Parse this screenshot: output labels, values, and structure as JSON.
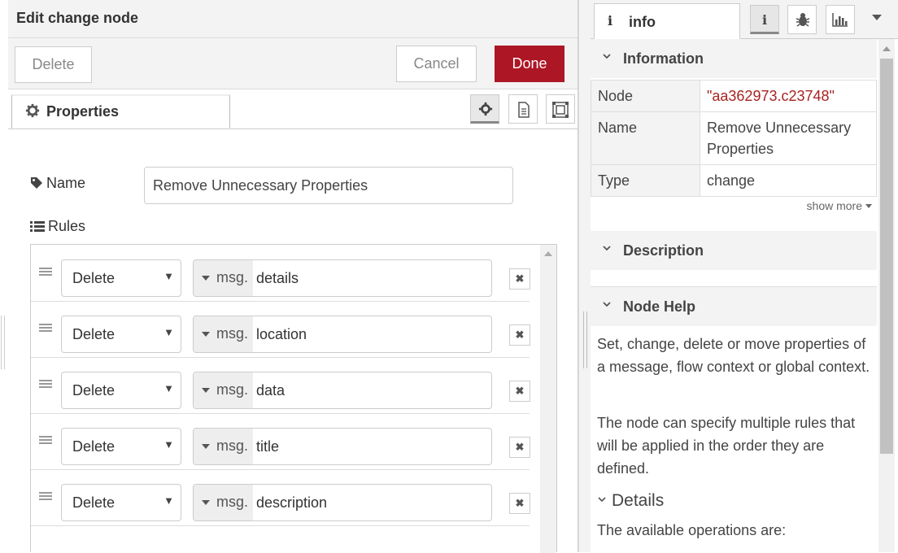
{
  "tray": {
    "title": "Edit change node",
    "delete_label": "Delete",
    "cancel_label": "Cancel",
    "done_label": "Done",
    "tab_properties": "Properties",
    "name_label": "Name",
    "name_value": "Remove Unnecessary Properties",
    "rules_label": "Rules",
    "rules": [
      {
        "action": "Delete",
        "prefix": "msg.",
        "property": "details"
      },
      {
        "action": "Delete",
        "prefix": "msg.",
        "property": "location"
      },
      {
        "action": "Delete",
        "prefix": "msg.",
        "property": "data"
      },
      {
        "action": "Delete",
        "prefix": "msg.",
        "property": "title"
      },
      {
        "action": "Delete",
        "prefix": "msg.",
        "property": "description"
      }
    ]
  },
  "sidebar": {
    "tab_info": "info",
    "information_title": "Information",
    "info_rows": [
      {
        "key": "Node",
        "value": "\"aa362973.c23748\""
      },
      {
        "key": "Name",
        "value": "Remove Unnecessary Properties"
      },
      {
        "key": "Type",
        "value": "change"
      }
    ],
    "show_more": "show more",
    "description_title": "Description",
    "node_help_title": "Node Help",
    "help_p1": "Set, change, delete or move properties of a message, flow context or global context.",
    "help_p2": "The node can specify multiple rules that will be applied in the order they are defined.",
    "details_title": "Details",
    "help_p3": "The available operations are:"
  },
  "colors": {
    "done_button": "#ad1625",
    "node_id": "#aa2222"
  }
}
